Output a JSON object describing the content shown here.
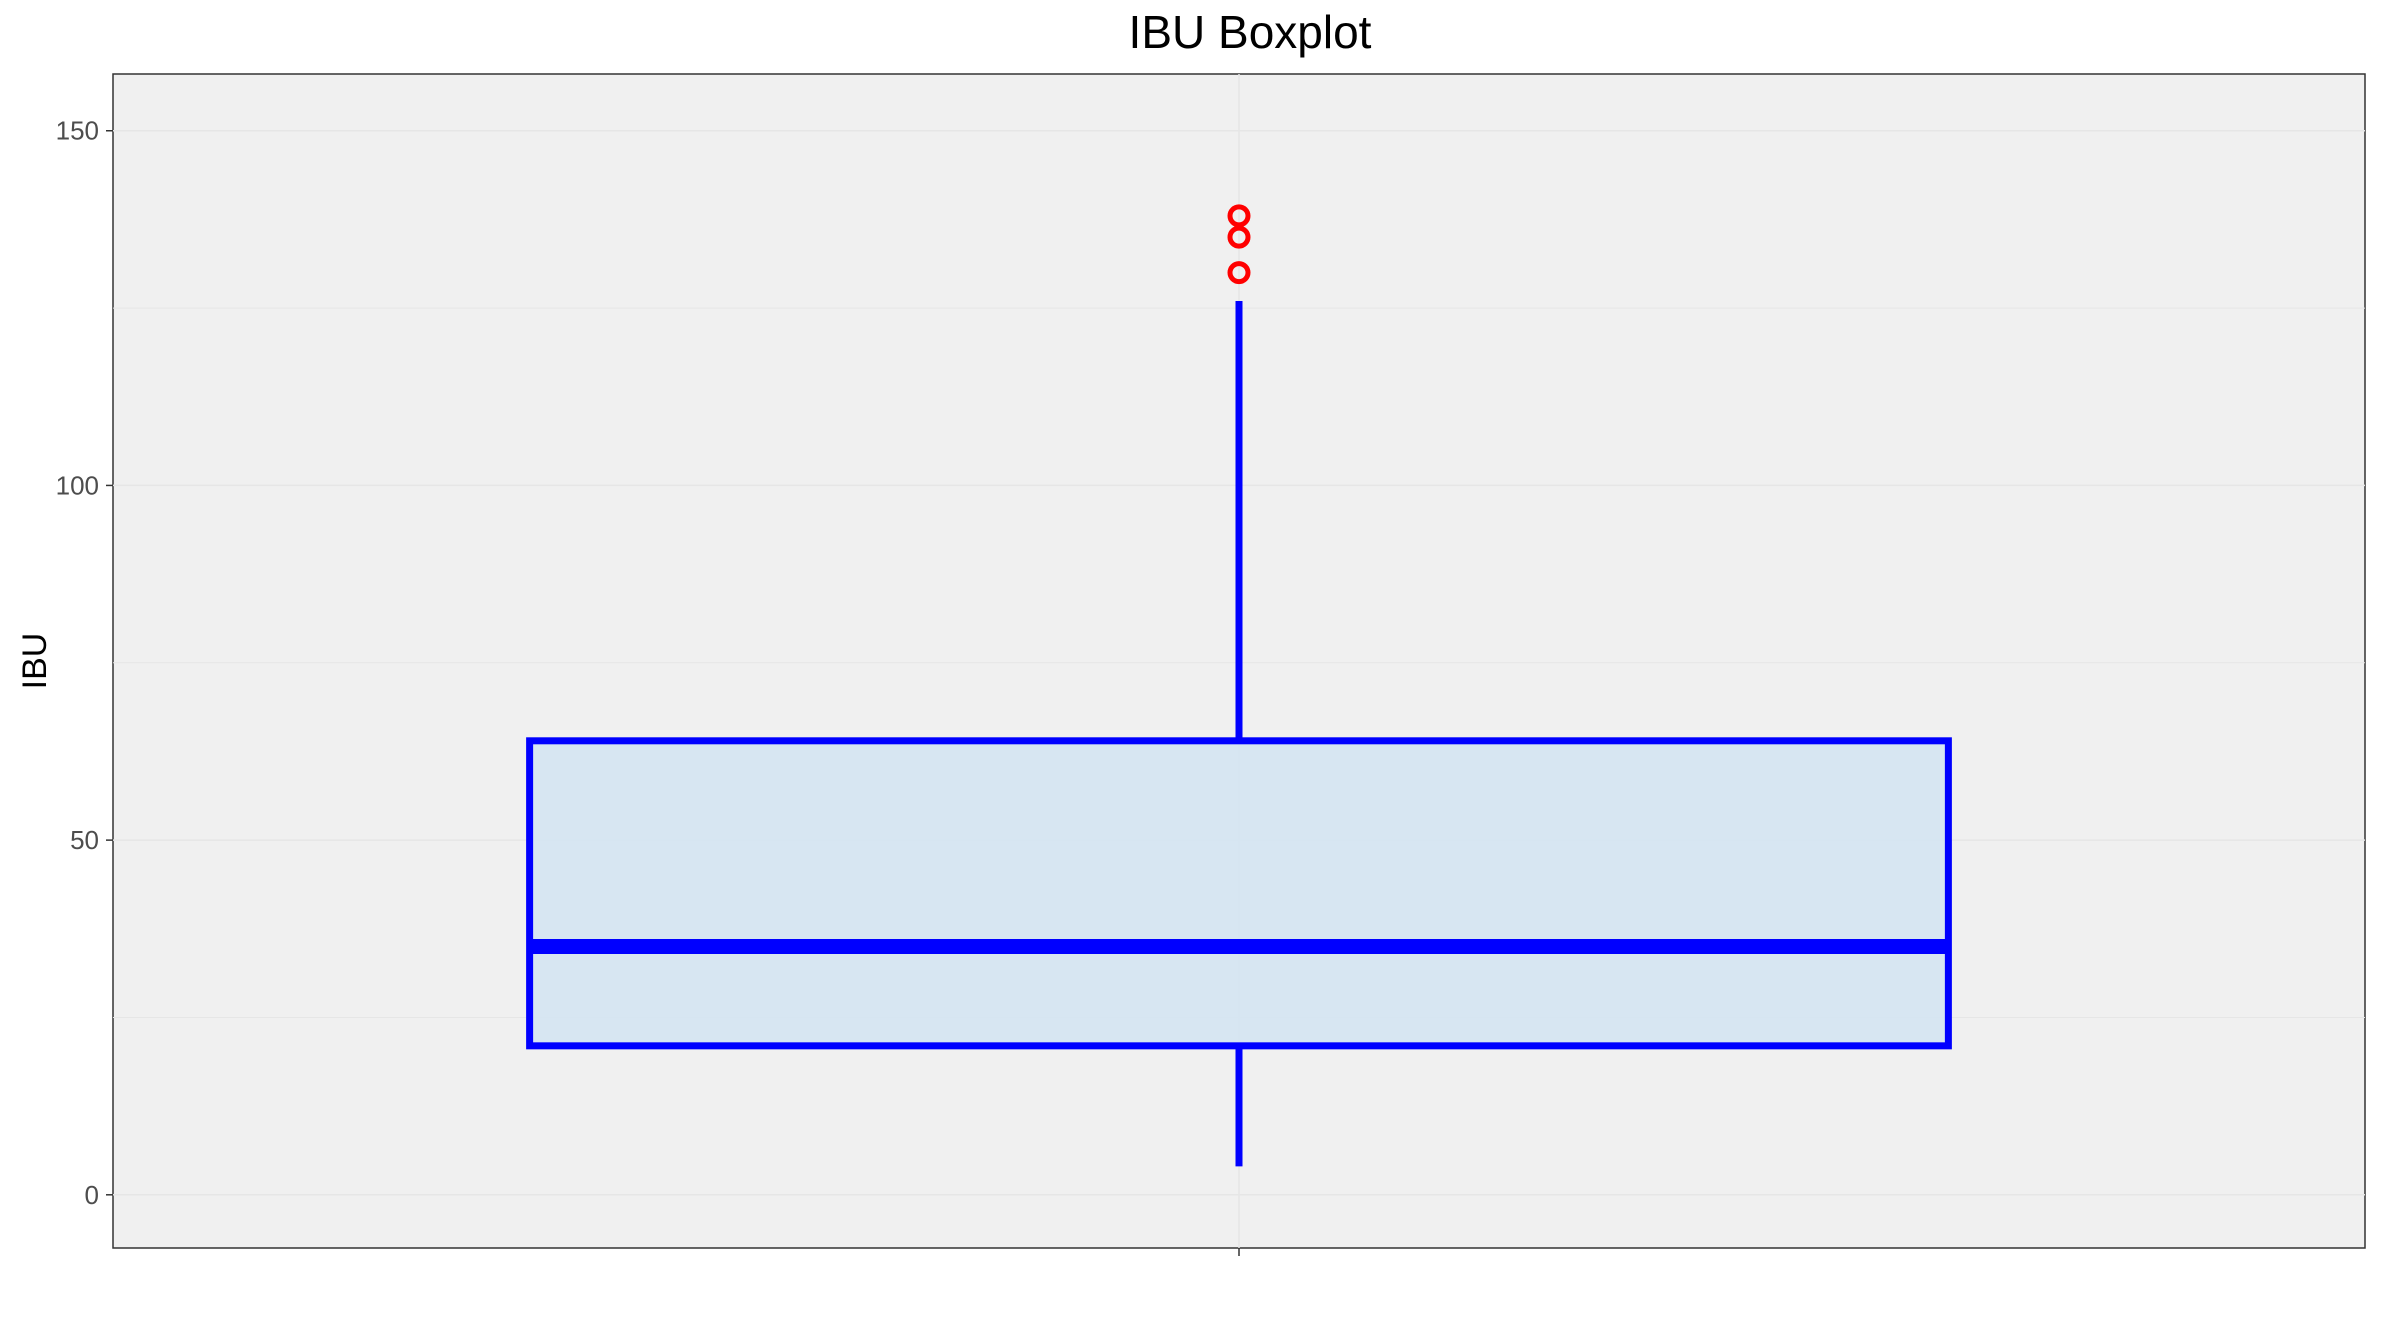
{
  "chart_data": {
    "type": "boxplot",
    "title": "IBU Boxplot",
    "xlabel": "",
    "ylabel": "IBU",
    "ylim": [
      -7.5,
      158
    ],
    "yticks": [
      0,
      50,
      100,
      150
    ],
    "grid": true,
    "box": {
      "min": 4,
      "q1": 21,
      "median": 35,
      "q3": 64,
      "max": 126,
      "outliers": [
        130,
        135,
        138
      ]
    },
    "colors": {
      "box_line": "#0000ff",
      "box_fill": "#d4e4f2",
      "outlier": "#ff0000",
      "panel_background": "#f0f0f0",
      "grid": "#e6e6e6"
    }
  }
}
